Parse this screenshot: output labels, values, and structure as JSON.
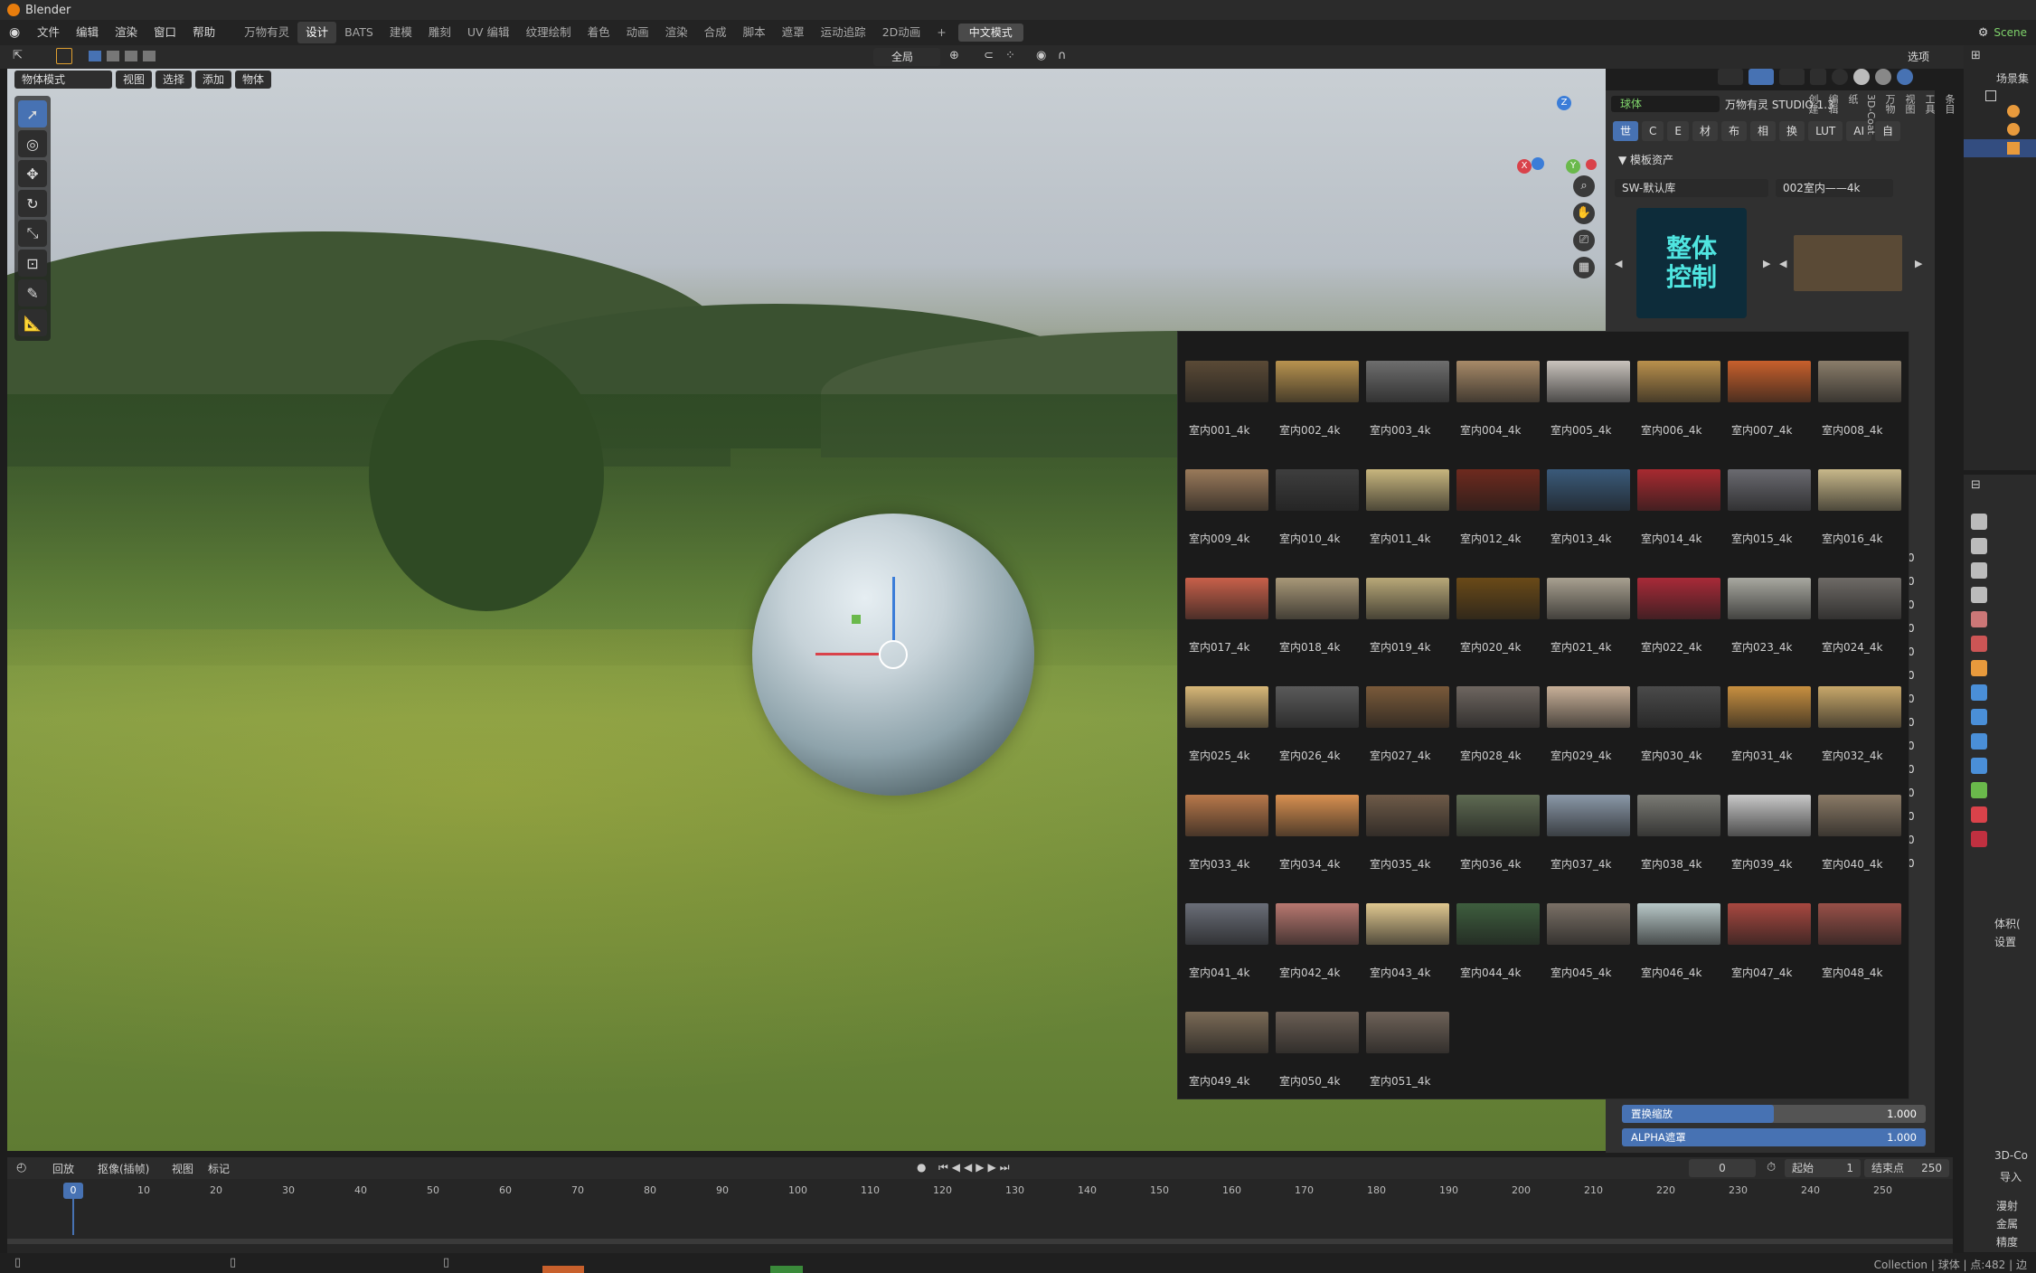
{
  "app_title": "Blender",
  "menu": [
    "文件",
    "编辑",
    "渲染",
    "窗口",
    "帮助"
  ],
  "workspaces": [
    "万物有灵",
    "设计",
    "BATS",
    "建模",
    "雕刻",
    "UV 编辑",
    "纹理绘制",
    "着色",
    "动画",
    "渲染",
    "合成",
    "脚本",
    "遮罩",
    "运动追踪",
    "2D动画"
  ],
  "workspace_active": "设计",
  "add_tab": "+",
  "lang_mode": "中文模式",
  "scene_name": "Scene",
  "header": {
    "transform_global": "全局",
    "options": "选项"
  },
  "viewport_header": {
    "mode": "物体模式",
    "view": "视图",
    "select": "选择",
    "add": "添加",
    "object": "物体"
  },
  "gizmo": {
    "x": "X",
    "y": "Y",
    "z": "Z"
  },
  "npanel": {
    "object_name": "球体",
    "plugin_title": "万物有灵 STUDIO 1.3",
    "tabs": [
      "世",
      "C",
      "E",
      "材",
      "布",
      "相",
      "换",
      "LUT",
      "AI",
      "自"
    ],
    "section": "模板资产",
    "library": "SW-默认库",
    "category": "002室内——4k",
    "preview_text": "整体\n控制",
    "side_tabs": [
      "条目",
      "工具",
      "视图",
      "万物",
      "3D-Coat",
      "纸",
      "编辑",
      "创建"
    ],
    "sliders": [
      {
        "label": "置换缩放",
        "value": "1.000",
        "fill": 0.5
      },
      {
        "label": "ALPHA遮罩",
        "value": "1.000",
        "fill": 1.0
      }
    ],
    "zero_values": [
      "0",
      "0",
      "0",
      "0",
      "0",
      "0",
      "0",
      "0",
      "0",
      "0",
      "0",
      "0",
      "0",
      "0"
    ]
  },
  "popup_items": [
    "室内001_4k",
    "室内002_4k",
    "室内003_4k",
    "室内004_4k",
    "室内005_4k",
    "室内006_4k",
    "室内007_4k",
    "室内008_4k",
    "室内009_4k",
    "室内010_4k",
    "室内011_4k",
    "室内012_4k",
    "室内013_4k",
    "室内014_4k",
    "室内015_4k",
    "室内016_4k",
    "室内017_4k",
    "室内018_4k",
    "室内019_4k",
    "室内020_4k",
    "室内021_4k",
    "室内022_4k",
    "室内023_4k",
    "室内024_4k",
    "室内025_4k",
    "室内026_4k",
    "室内027_4k",
    "室内028_4k",
    "室内029_4k",
    "室内030_4k",
    "室内031_4k",
    "室内032_4k",
    "室内033_4k",
    "室内034_4k",
    "室内035_4k",
    "室内036_4k",
    "室内037_4k",
    "室内038_4k",
    "室内039_4k",
    "室内040_4k",
    "室内041_4k",
    "室内042_4k",
    "室内043_4k",
    "室内044_4k",
    "室内045_4k",
    "室内046_4k",
    "室内047_4k",
    "室内048_4k",
    "室内049_4k",
    "室内050_4k",
    "室内051_4k"
  ],
  "popup_colors": [
    "#5a4a36",
    "#b8934f",
    "#6e6e6e",
    "#a78a68",
    "#c9c3bd",
    "#b9904c",
    "#c8602c",
    "#8a7d6a",
    "#9a7a5a",
    "#3e3e3e",
    "#c8b67e",
    "#6e2a1e",
    "#3a5a7a",
    "#a82a30",
    "#6a6a70",
    "#c8b88a",
    "#c8604a",
    "#a89878",
    "#b8a878",
    "#6a4a18",
    "#a8a090",
    "#a82a38",
    "#a8a8a0",
    "#6e6a66",
    "#d8b878",
    "#5a5a5a",
    "#7a5a3a",
    "#6e6660",
    "#c8b098",
    "#4a4a4a",
    "#c89040",
    "#c8a86a",
    "#b8784a",
    "#d89050",
    "#6e5a48",
    "#5e6a52",
    "#8a98a8",
    "#7a7a74",
    "#c8c8c8",
    "#8a7a66",
    "#6a6e78",
    "#b87870",
    "#e0c890",
    "#3e5e3e",
    "#7a7066",
    "#b8c8c8",
    "#a84840",
    "#985048",
    "#7a6a56",
    "#6a5e54",
    "#6e6258"
  ],
  "timeline": {
    "menus": [
      "回放",
      "抠像(插帧)",
      "视图",
      "标记"
    ],
    "current_frame": "0",
    "start_label": "起始",
    "start": "1",
    "end_label": "结束点",
    "end": "250",
    "frame_display": "0",
    "ticks": [
      "0",
      "10",
      "20",
      "30",
      "40",
      "50",
      "60",
      "70",
      "80",
      "90",
      "100",
      "110",
      "120",
      "130",
      "140",
      "150",
      "160",
      "170",
      "180",
      "190",
      "200",
      "210",
      "220",
      "230",
      "240",
      "250"
    ]
  },
  "outliner": {
    "title": "场景集",
    "items": [
      "",
      "",
      ""
    ]
  },
  "props": {
    "labels": [
      "体积(",
      "设置",
      "3D-Co",
      "导入"
    ],
    "checks": [
      "漫射",
      "金属",
      "精度"
    ]
  },
  "status": "Collection | 球体 | 点:482 | 边"
}
